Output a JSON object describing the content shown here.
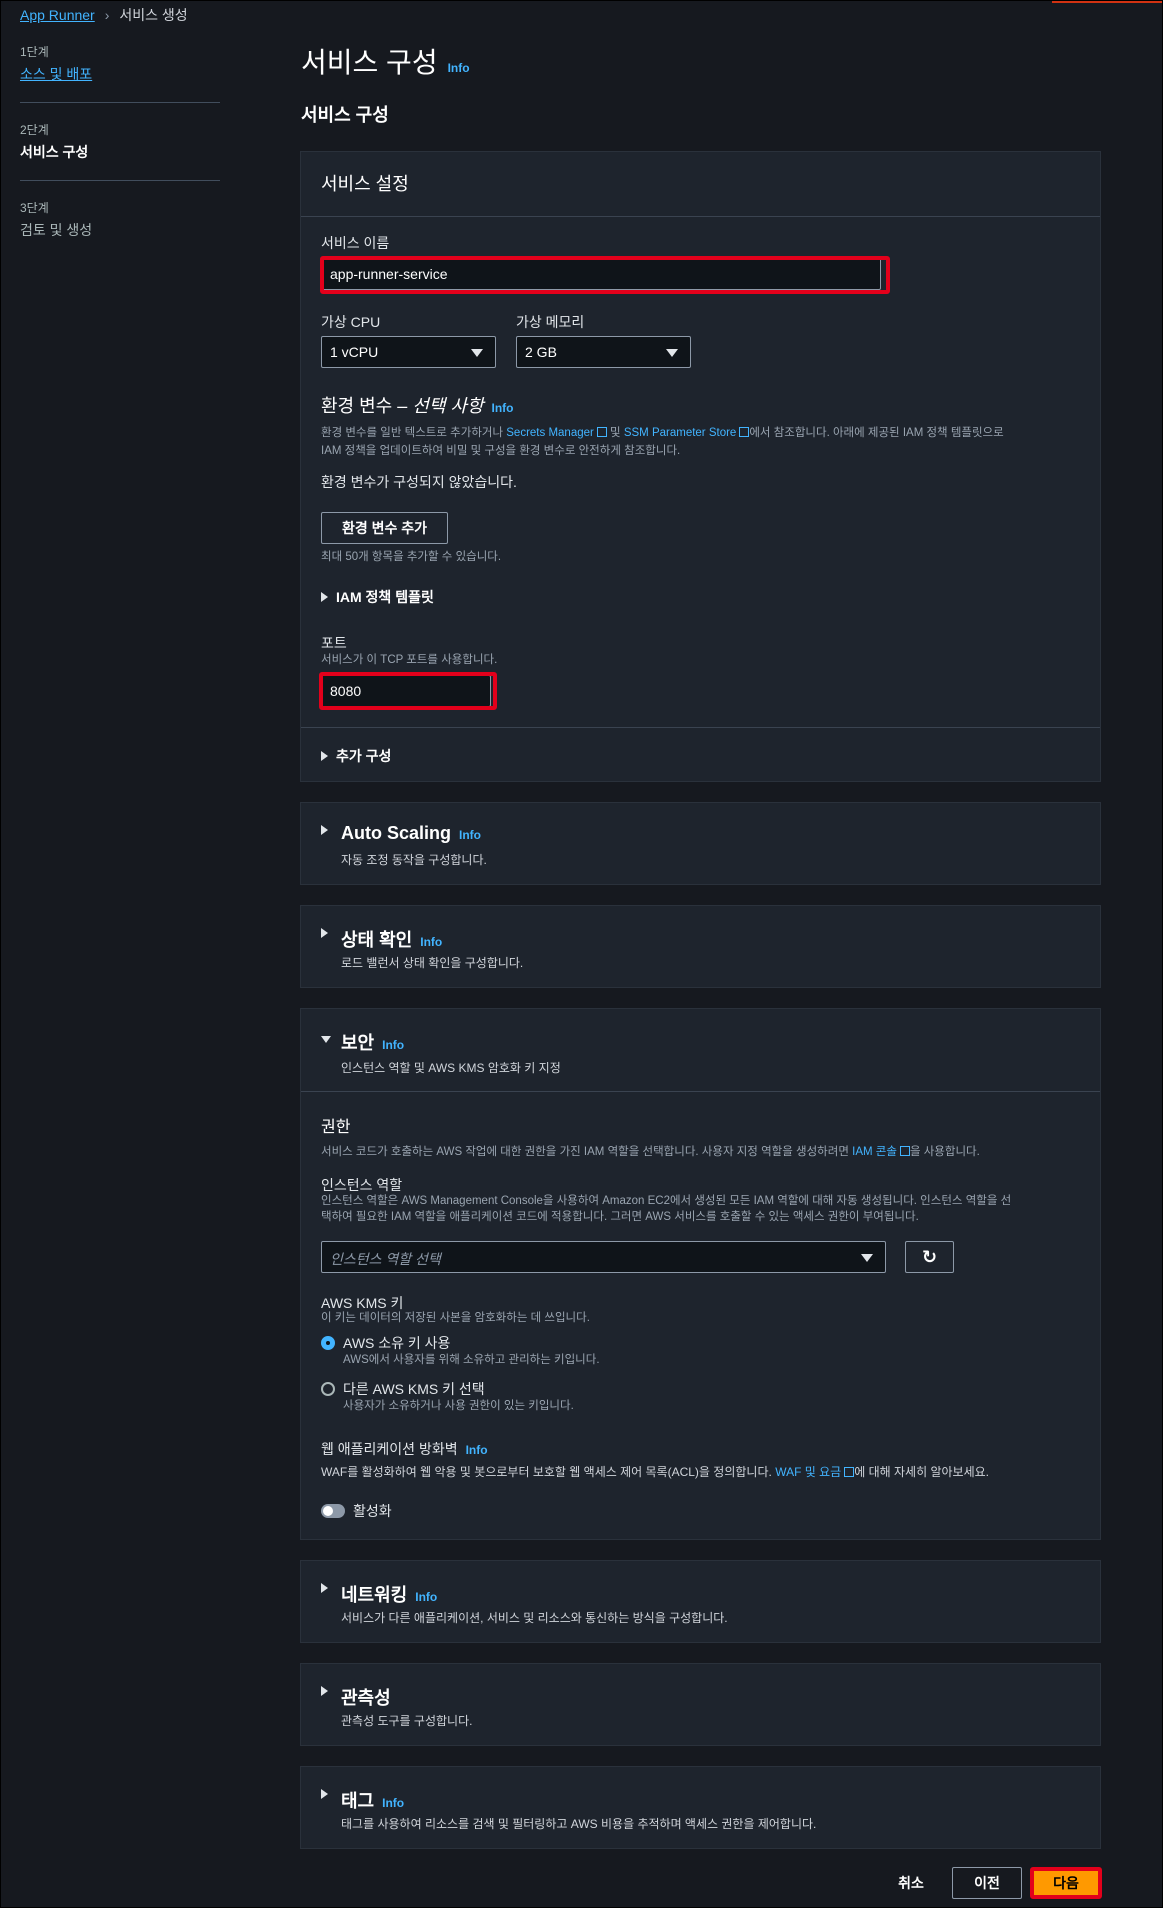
{
  "breadcrumb": {
    "root": "App Runner",
    "current": "서비스 생성"
  },
  "steps": [
    {
      "num": "1단계",
      "label": "소스 및 배포"
    },
    {
      "num": "2단계",
      "label": "서비스 구성"
    },
    {
      "num": "3단계",
      "label": "검토 및 생성"
    }
  ],
  "page": {
    "title": "서비스 구성",
    "info": "Info",
    "subtitle": "서비스 구성"
  },
  "service_settings": {
    "header": "서비스 설정",
    "name_label": "서비스 이름",
    "name_value": "app-runner-service",
    "cpu_label": "가상 CPU",
    "cpu_value": "1 vCPU",
    "memory_label": "가상 메모리",
    "memory_value": "2 GB",
    "env_title": "환경 변수 – ",
    "env_title_optional": "선택 사항",
    "env_info": "Info",
    "env_desc_1": "환경 변수를 일반 텍스트로 추가하거나 ",
    "env_link_secrets": "Secrets Manager",
    "env_desc_2": " 및 ",
    "env_link_ssm": "SSM Parameter Store",
    "env_desc_3": "에서 참조합니다. 아래에 제공된 IAM 정책 템플릿으로",
    "env_desc_4": "IAM 정책을 업데이트하여 비밀 및 구성을 환경 변수로 안전하게 참조합니다.",
    "env_empty": "환경 변수가 구성되지 않았습니다.",
    "env_add_button": "환경 변수 추가",
    "env_limit": "최대 50개 항목을 추가할 수 있습니다.",
    "iam_template": "IAM 정책 템플릿",
    "port_label": "포트",
    "port_desc": "서비스가 이 TCP 포트를 사용합니다.",
    "port_value": "8080",
    "additional": "추가 구성"
  },
  "auto_scaling": {
    "title": "Auto Scaling",
    "info": "Info",
    "desc": "자동 조정 동작을 구성합니다."
  },
  "health_check": {
    "title": "상태 확인",
    "info": "Info",
    "desc": "로드 밸런서 상태 확인을 구성합니다."
  },
  "security": {
    "title": "보안",
    "info": "Info",
    "desc": "인스턴스 역할 및 AWS KMS 암호화 키 지정",
    "perm_title": "권한",
    "perm_desc_1": "서비스 코드가 호출하는 AWS 작업에 대한 권한을 가진 IAM 역할을 선택합니다. 사용자 지정 역할을 생성하려면 ",
    "perm_link": "IAM 콘솔",
    "perm_desc_2": "을 사용합니다.",
    "role_label": "인스턴스 역할",
    "role_desc_1": "인스턴스 역할은 AWS Management Console을 사용하여 Amazon EC2에서 생성된 모든 IAM 역할에 대해 자동 생성됩니다. 인스턴스 역할을 선",
    "role_desc_2": "택하여 필요한 IAM 역할을 애플리케이션 코드에 적용합니다. 그러면 AWS 서비스를 호출할 수 있는 액세스 권한이 부여됩니다.",
    "role_placeholder": "인스턴스 역할 선택",
    "kms_label": "AWS KMS 키",
    "kms_desc": "이 키는 데이터의 저장된 사본을 암호화하는 데 쓰입니다.",
    "kms_opt1": "AWS 소유 키 사용",
    "kms_opt1_desc": "AWS에서 사용자를 위해 소유하고 관리하는 키입니다.",
    "kms_opt2": "다른 AWS KMS 키 선택",
    "kms_opt2_desc": "사용자가 소유하거나 사용 권한이 있는 키입니다.",
    "waf_title": "웹 애플리케이션 방화벽",
    "waf_info": "Info",
    "waf_desc_1": "WAF를 활성화하여 웹 악용 및 봇으로부터 보호할 웹 액세스 제어 목록(ACL)을 정의합니다. ",
    "waf_link": "WAF 및 요금",
    "waf_desc_2": "에 대해 자세히 알아보세요.",
    "waf_toggle": "활성화"
  },
  "networking": {
    "title": "네트워킹",
    "info": "Info",
    "desc": "서비스가 다른 애플리케이션, 서비스 및 리소스와 통신하는 방식을 구성합니다."
  },
  "observability": {
    "title": "관측성",
    "desc": "관측성 도구를 구성합니다."
  },
  "tags": {
    "title": "태그",
    "info": "Info",
    "desc": "태그를 사용하여 리소스를 검색 및 필터링하고 AWS 비용을 추적하며 액세스 권한을 제어합니다."
  },
  "footer": {
    "cancel": "취소",
    "prev": "이전",
    "next": "다음"
  },
  "colors": {
    "accent": "#42b4ff",
    "primary": "#ff9900",
    "highlight": "#e3001b"
  }
}
